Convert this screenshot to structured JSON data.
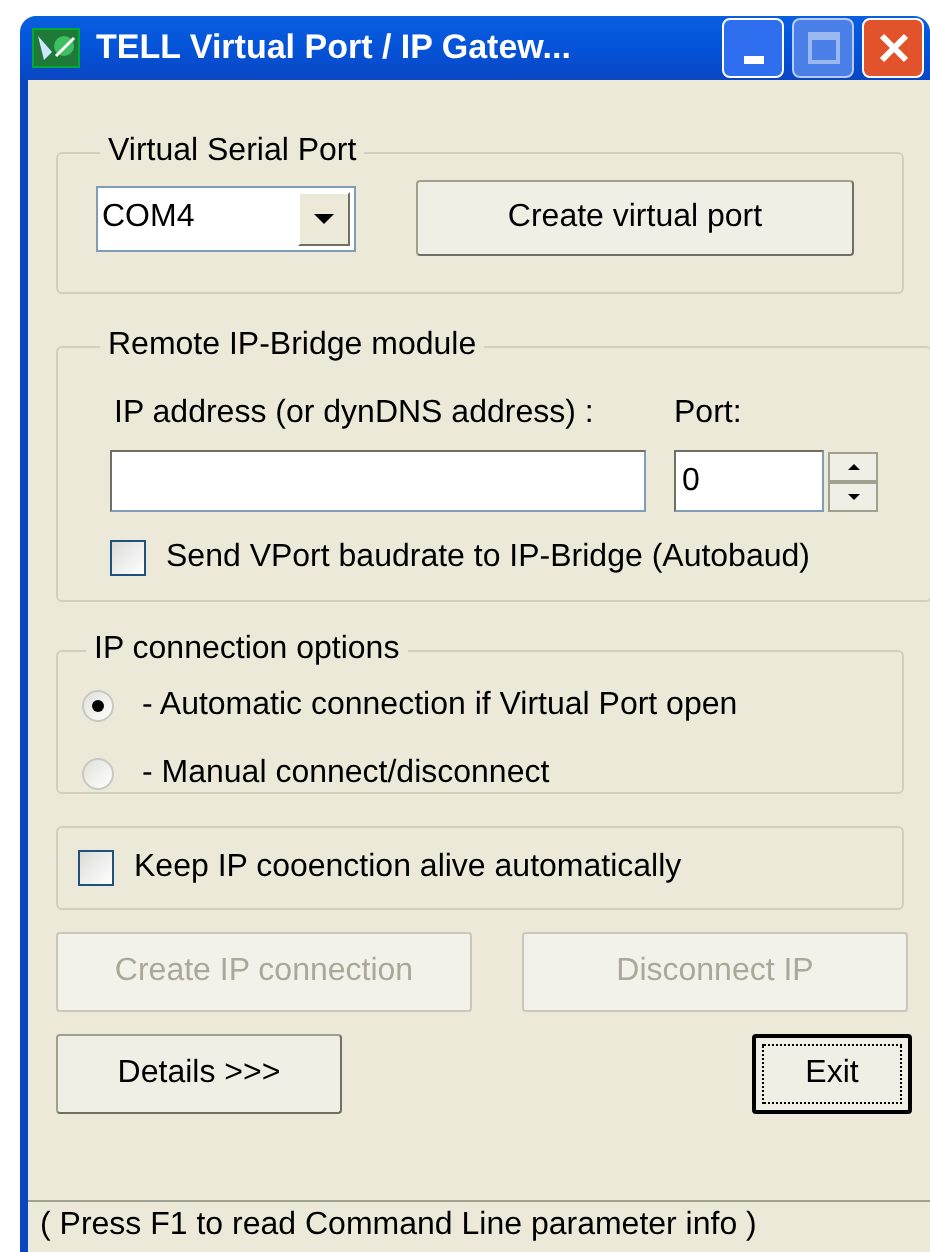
{
  "window": {
    "title": "TELL Virtual Port / IP Gatew..."
  },
  "virtual_serial_port": {
    "legend": "Virtual Serial Port",
    "port_value": "COM4",
    "create_button": "Create virtual port"
  },
  "ip_bridge": {
    "legend": "Remote IP-Bridge module",
    "ip_label": "IP address (or dynDNS address) :",
    "port_label": "Port:",
    "port_value": "0",
    "autobaud": {
      "label": "Send VPort baudrate to IP-Bridge (Autobaud)",
      "checked": false
    }
  },
  "connection_options": {
    "legend": "IP connection options",
    "options": [
      {
        "label": "- Automatic connection if Virtual Port open",
        "selected": true
      },
      {
        "label": "- Manual connect/disconnect",
        "selected": false
      }
    ]
  },
  "keep_alive": {
    "label": "Keep IP cooenction alive automatically",
    "checked": false
  },
  "connection_buttons": [
    {
      "label": "Create IP connection",
      "disabled": true
    },
    {
      "label": "Disconnect IP",
      "disabled": true
    }
  ],
  "bottom_buttons": [
    {
      "label": "Details >>>",
      "focused": false
    },
    {
      "label": "Exit",
      "focused": true
    }
  ],
  "status_bar": "( Press F1 to read Command Line parameter info )"
}
